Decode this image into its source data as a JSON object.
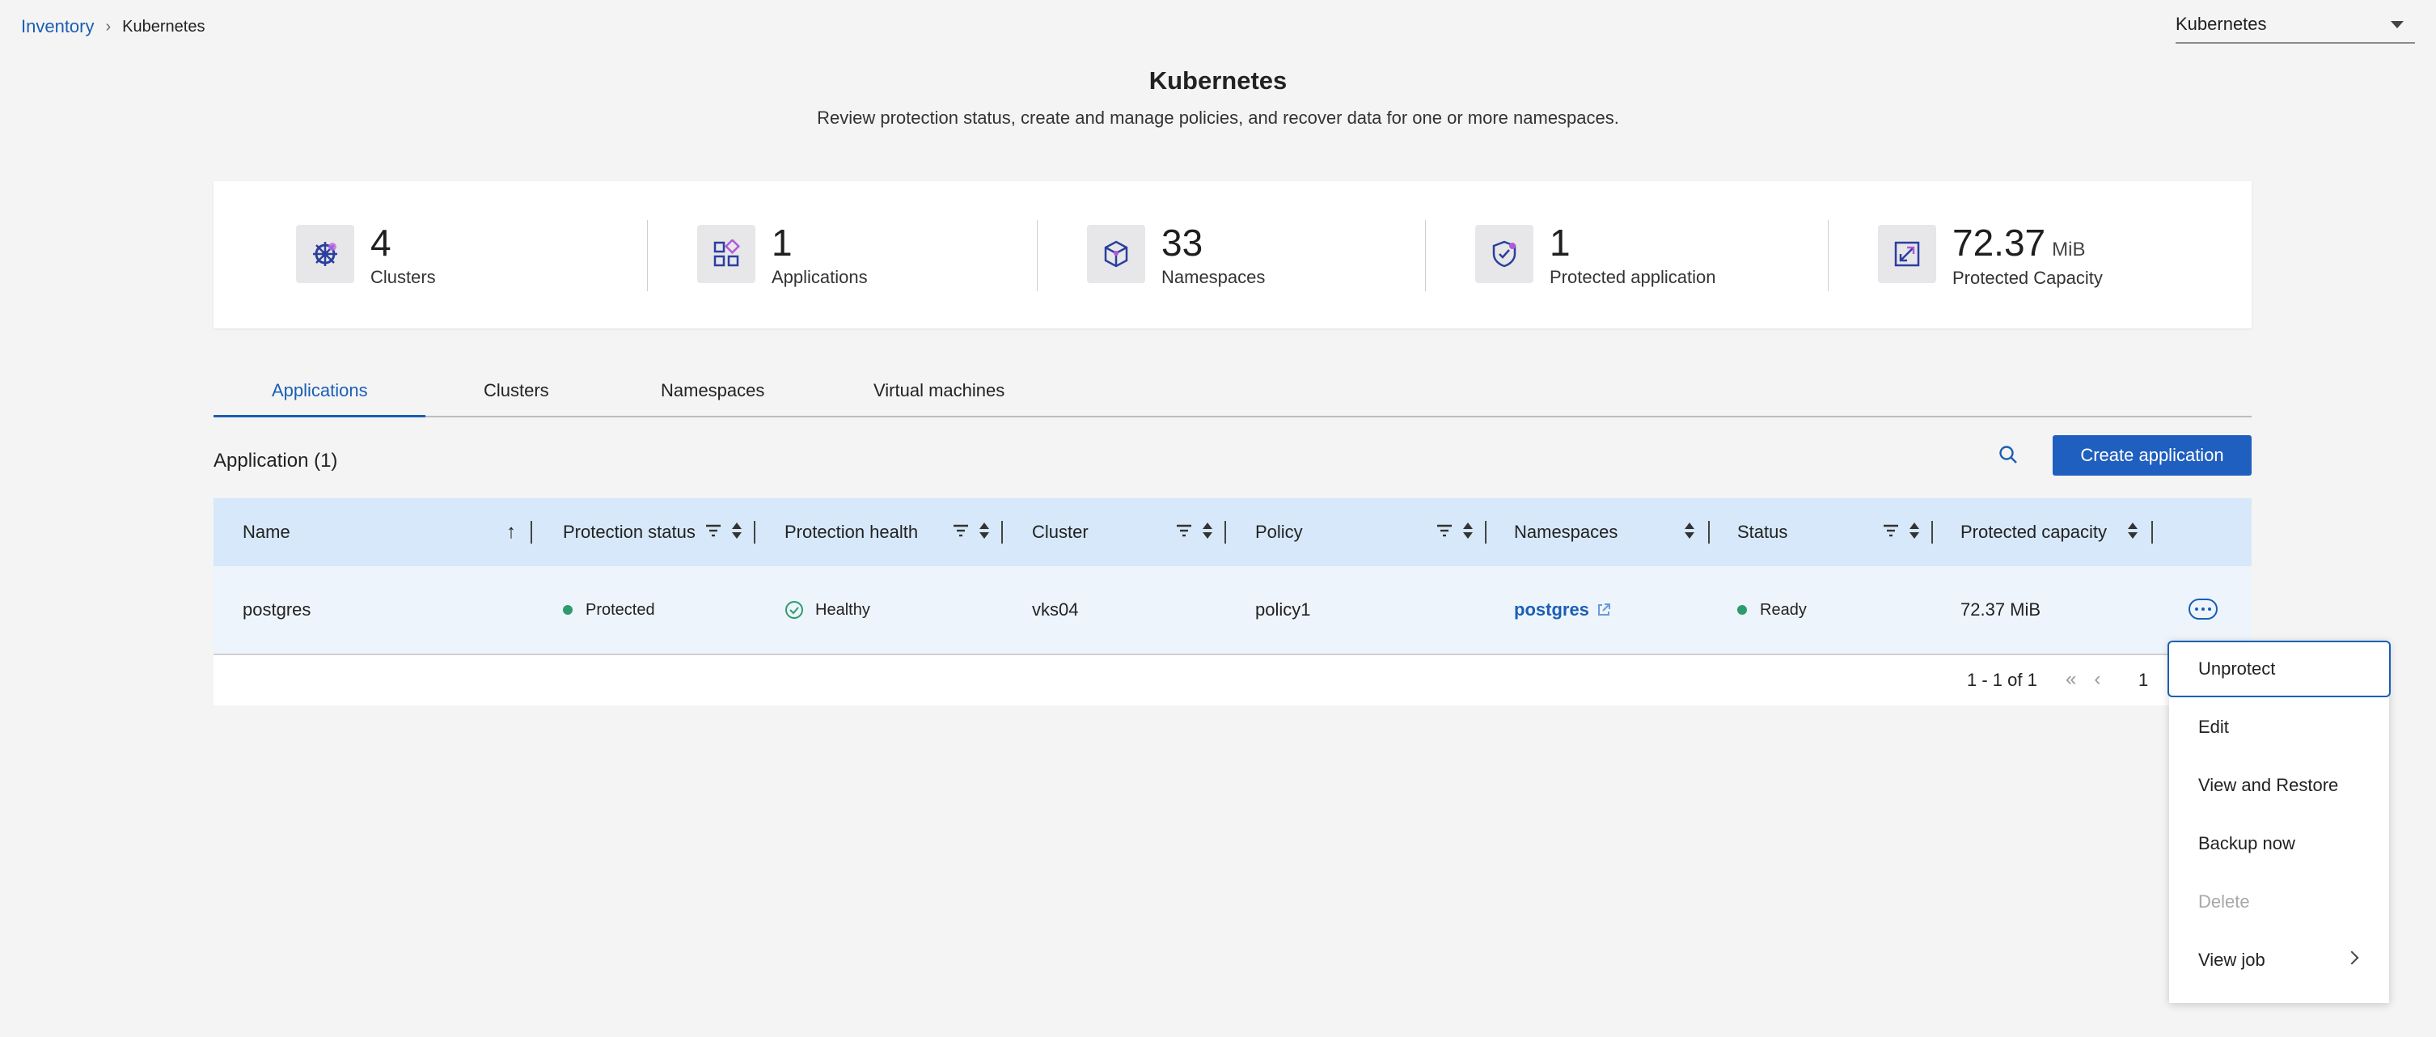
{
  "breadcrumb": {
    "root": "Inventory",
    "current": "Kubernetes"
  },
  "product_select": {
    "value": "Kubernetes"
  },
  "header": {
    "title": "Kubernetes",
    "subtitle": "Review protection status, create and manage policies, and recover data for one or more namespaces."
  },
  "summary": {
    "clusters": {
      "value": "4",
      "label": "Clusters",
      "icon": "kubernetes-wheel-icon"
    },
    "applications": {
      "value": "1",
      "label": "Applications",
      "icon": "apps-grid-icon"
    },
    "namespaces": {
      "value": "33",
      "label": "Namespaces",
      "icon": "cube-icon"
    },
    "protected_apps": {
      "value": "1",
      "label": "Protected application",
      "icon": "shield-check-icon"
    },
    "capacity": {
      "value": "72.37",
      "unit": "MiB",
      "label": "Protected Capacity",
      "icon": "expand-icon"
    }
  },
  "tabs": {
    "applications": "Applications",
    "clusters": "Clusters",
    "namespaces": "Namespaces",
    "vms": "Virtual machines"
  },
  "toolbar": {
    "section_title": "Application (1)",
    "create_label": "Create application"
  },
  "table": {
    "headers": {
      "name": "Name",
      "protection_status": "Protection status",
      "protection_health": "Protection health",
      "cluster": "Cluster",
      "policy": "Policy",
      "namespaces": "Namespaces",
      "status": "Status",
      "capacity": "Protected capacity"
    },
    "row": {
      "name": "postgres",
      "protection_status": "Protected",
      "protection_health": "Healthy",
      "cluster": "vks04",
      "policy": "policy1",
      "namespaces": "postgres",
      "status": "Ready",
      "capacity": "72.37 MiB"
    },
    "pagination": {
      "range": "1 - 1 of 1",
      "page": "1"
    }
  },
  "menu": {
    "unprotect": "Unprotect",
    "edit": "Edit",
    "view_restore": "View and Restore",
    "backup_now": "Backup now",
    "delete": "Delete",
    "view_job": "View job"
  },
  "colors": {
    "accent": "#1f5fbf",
    "header_row": "#d6e8f9",
    "status_green": "#2e9b6e"
  }
}
